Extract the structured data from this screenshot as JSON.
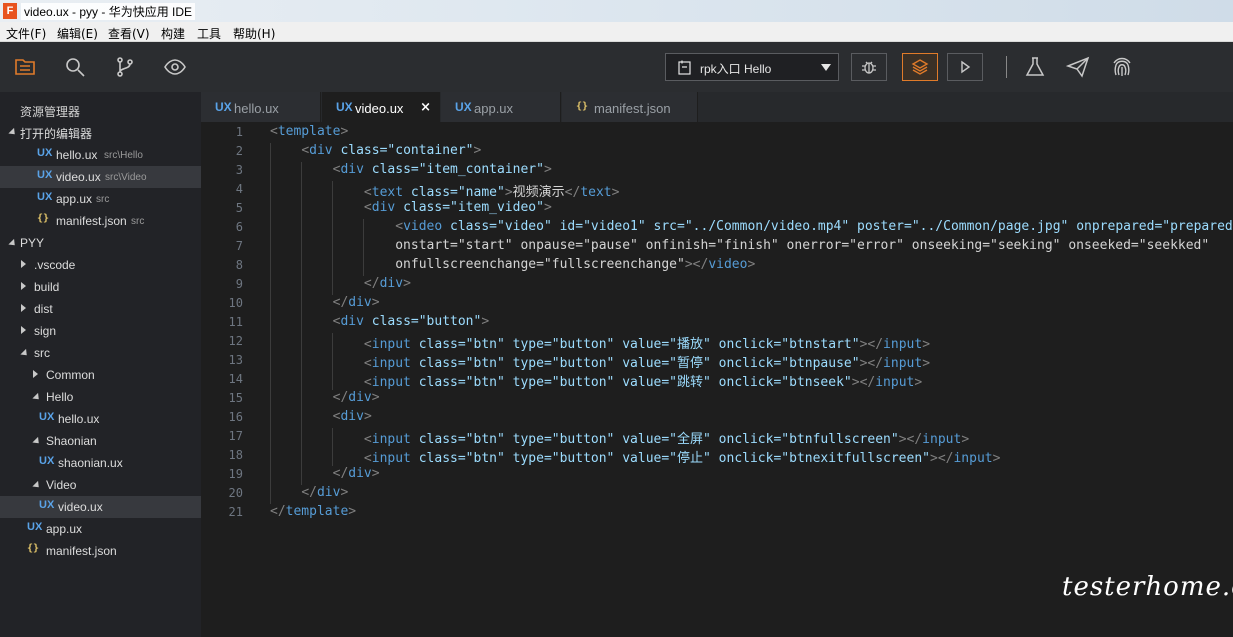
{
  "window": {
    "title": "video.ux - pyy - 华为快应用 IDE",
    "logo_letter": "F"
  },
  "menu": [
    "文件(F)",
    "编辑(E)",
    "查看(V)",
    "构建",
    "工具",
    "帮助(H)"
  ],
  "toolbar": {
    "left_icons": [
      "explorer-icon",
      "search-icon",
      "source-control-icon",
      "preview-eye-icon"
    ],
    "entry_select": {
      "value": "rpk入口 Hello",
      "icon": "page-icon"
    },
    "right_buttons": [
      "debug-bug-icon",
      "layers-icon",
      "run-play-icon"
    ],
    "right_icons": [
      "flask-test-icon",
      "send-publish-icon",
      "fingerprint-icon"
    ]
  },
  "sidebar": {
    "title": "资源管理器",
    "open_editors_label": "打开的编辑器",
    "open_editors": [
      {
        "badge": "UX",
        "name": "hello.ux",
        "path": "src\\Hello"
      },
      {
        "badge": "UX",
        "name": "video.ux",
        "path": "src\\Video",
        "selected": true
      },
      {
        "badge": "UX",
        "name": "app.ux",
        "path": "src"
      },
      {
        "badge": "{}",
        "name": "manifest.json",
        "path": "src"
      }
    ],
    "project_label": "PYY",
    "tree": [
      {
        "name": ".vscode"
      },
      {
        "name": "build"
      },
      {
        "name": "dist"
      },
      {
        "name": "sign"
      },
      {
        "name": "src"
      },
      {
        "name": "Common"
      },
      {
        "name": "Hello"
      },
      {
        "badge": "UX",
        "name": "hello.ux"
      },
      {
        "name": "Shaonian"
      },
      {
        "badge": "UX",
        "name": "shaonian.ux"
      },
      {
        "name": "Video"
      },
      {
        "badge": "UX",
        "name": "video.ux"
      },
      {
        "badge": "UX",
        "name": "app.ux"
      },
      {
        "badge": "{}",
        "name": "manifest.json"
      }
    ]
  },
  "tabs": [
    {
      "badge": "UX",
      "name": "hello.ux"
    },
    {
      "badge": "UX",
      "name": "video.ux",
      "active": true,
      "close": "×"
    },
    {
      "badge": "UX",
      "name": "app.ux"
    },
    {
      "badge": "{}",
      "name": "manifest.json"
    }
  ],
  "editor": {
    "lines": [
      "<template>",
      "    <div class=\"container\">",
      "        <div class=\"item_container\">",
      "            <text class=\"name\">视频演示</text>",
      "            <div class=\"item_video\">",
      "                <video class=\"video\" id=\"video1\" src=\"../Common/video.mp4\" poster=\"../Common/page.jpg\" onprepared=\"prepared\"",
      "                onstart=\"start\" onpause=\"pause\" onfinish=\"finish\" onerror=\"error\" onseeking=\"seeking\" onseeked=\"seekked\"",
      "                onfullscreenchange=\"fullscreenchange\"></video>",
      "            </div>",
      "        </div>",
      "        <div class=\"button\">",
      "            <input class=\"btn\" type=\"button\" value=\"播放\" onclick=\"btnstart\"></input>",
      "            <input class=\"btn\" type=\"button\" value=\"暂停\" onclick=\"btnpause\"></input>",
      "            <input class=\"btn\" type=\"button\" value=\"跳转\" onclick=\"btnseek\"></input>",
      "        </div>",
      "        <div>",
      "            <input class=\"btn\" type=\"button\" value=\"全屏\" onclick=\"btnfullscreen\"></input>",
      "            <input class=\"btn\" type=\"button\" value=\"停止\" onclick=\"btnexitfullscreen\"></input>",
      "        </div>",
      "    </div>",
      "</template>"
    ]
  },
  "watermark": "testerhome.com",
  "colors": {
    "accent": "#e07b2a",
    "ux_badge": "#5aa3e8",
    "json_badge": "#e0c36a",
    "tag": "#569cd6",
    "attr": "#9cdcfe",
    "string": "#ce9178"
  }
}
